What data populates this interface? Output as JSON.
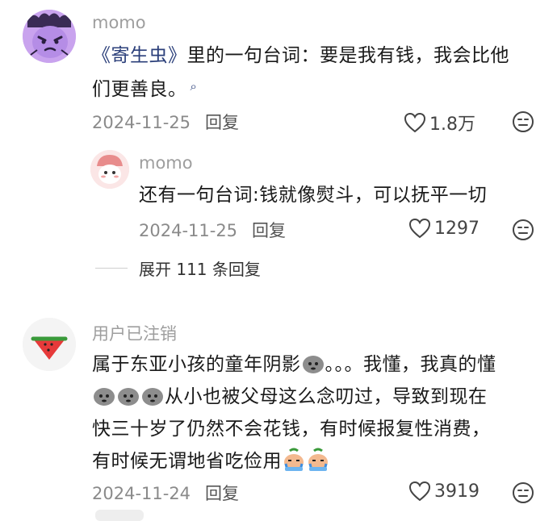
{
  "comments": [
    {
      "username": "momo",
      "text_link": "《寄生虫》",
      "text_line1_rest": "里的一句台词：要是我有钱，我会比他",
      "text_line2": "们更善良。",
      "search_glyph": "⌕",
      "date": "2024-11-25",
      "reply_label": "回复",
      "likes": "1.8万"
    },
    {
      "username": "momo",
      "text": "还有一句台词:钱就像熨斗，可以抚平一切",
      "date": "2024-11-25",
      "reply_label": "回复",
      "likes": "1297"
    },
    {
      "username": "用户已注销",
      "line1_a": "属于东亚小孩的童年阴影",
      "line1_b": "。。。我懂，我真的懂",
      "line2": "从小也被父母这么念叨过，导致到现在",
      "line3": "快三十岁了仍然不会花钱，有时候报复性消费，",
      "line4": "有时候无谓地省吃俭用",
      "date": "2024-11-24",
      "reply_label": "回复",
      "likes": "3919"
    }
  ],
  "expand_replies": "展开 111 条回复",
  "icons": {
    "heart": "heart-icon",
    "dislike": "dislike-face-icon"
  }
}
